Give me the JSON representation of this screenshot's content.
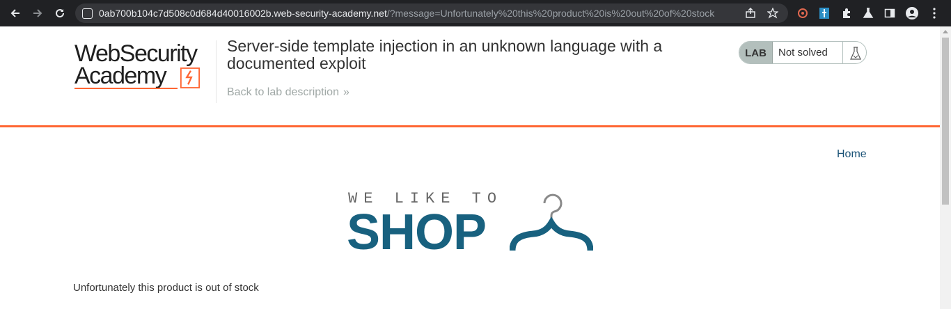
{
  "browser": {
    "url_host": "0ab700b104c7d508c0d684d40016002b.web-security-academy.net",
    "url_rest": "/?message=Unfortunately%20this%20product%20is%20out%20of%20stock"
  },
  "header": {
    "logo_line1": "WebSecurity",
    "logo_line2": "Academy",
    "lab_title": "Server-side template injection in an unknown language with a documented exploit",
    "back_link": "Back to lab description",
    "back_chevron": "»",
    "lab_label": "LAB",
    "lab_status": "Not solved"
  },
  "nav": {
    "home": "Home"
  },
  "shop_logo": {
    "tagline": "WE LIKE TO",
    "word": "SHOP"
  },
  "main": {
    "message": "Unfortunately this product is out of stock"
  },
  "colors": {
    "accent_orange": "#ff6633",
    "shop_blue": "#18617f",
    "link_blue": "#1a5276"
  }
}
